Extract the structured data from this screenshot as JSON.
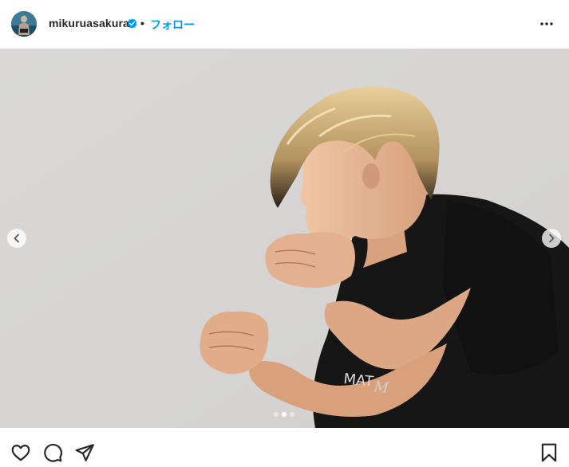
{
  "post": {
    "username": "mikuruasakura",
    "separator": "•",
    "follow_label": "フォロー",
    "verified": true,
    "media_count": 3,
    "active_media_index": 2
  },
  "colors": {
    "follow_blue": "#0095f6",
    "verified_blue": "#0095f6",
    "text": "#262626"
  },
  "icons": {
    "more": "more-horizontal-icon",
    "prev": "chevron-left-icon",
    "next": "chevron-right-icon",
    "like": "heart-icon",
    "comment": "comment-icon",
    "share": "paper-plane-icon",
    "save": "bookmark-icon"
  }
}
